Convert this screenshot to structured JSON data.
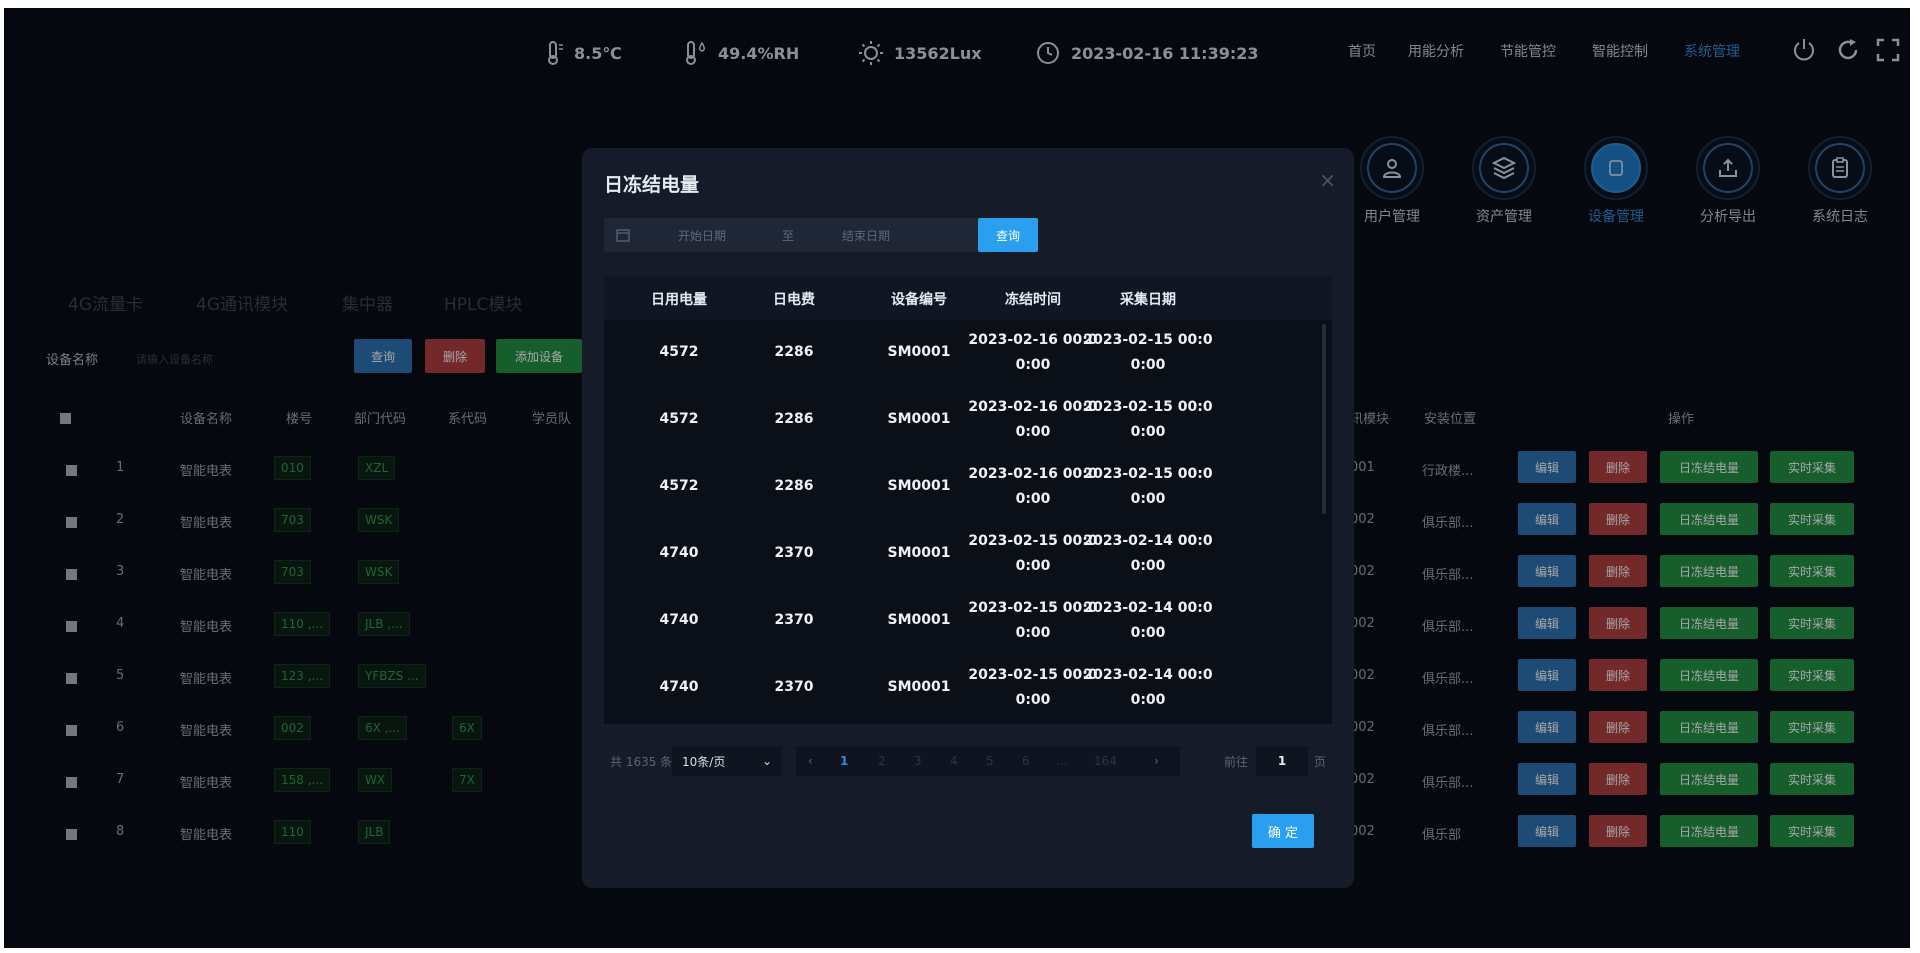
{
  "status": {
    "temperature": "8.5℃",
    "humidity": "49.4%RH",
    "illuminance": "13562Lux",
    "datetime": "2023-02-16 11:39:23"
  },
  "topnav": [
    "首页",
    "用能分析",
    "节能管控",
    "智能控制",
    "系统管理"
  ],
  "system_menu": [
    "用户管理",
    "资产管理",
    "设备管理",
    "分析导出",
    "系统日志"
  ],
  "background": {
    "device_tabs": [
      "4G流量卡",
      "4G通讯模块",
      "集中器",
      "HPLC模块"
    ],
    "filter_label": "设备名称",
    "filter_placeholder": "请输入设备名称",
    "query": "查询",
    "delete": "删除",
    "add_device": "添加设备",
    "columns": [
      "设备名称",
      "楼号",
      "部门代码",
      "系代码",
      "学员队"
    ],
    "right_columns": [
      "讯模块",
      "安装位置",
      "操作"
    ],
    "row_actions": {
      "edit": "编辑",
      "delete": "删除",
      "freeze": "日冻结电量",
      "realtime": "实时采集"
    },
    "rows": [
      {
        "idx": "1",
        "name": "智能电表",
        "building": "010",
        "dept": "XZL",
        "sys": "",
        "module": "001",
        "loc": "行政楼..."
      },
      {
        "idx": "2",
        "name": "智能电表",
        "building": "703",
        "dept": "WSK",
        "sys": "",
        "module": "002",
        "loc": "俱乐部..."
      },
      {
        "idx": "3",
        "name": "智能电表",
        "building": "703",
        "dept": "WSK",
        "sys": "",
        "module": "002",
        "loc": "俱乐部..."
      },
      {
        "idx": "4",
        "name": "智能电表",
        "building": "110 ,...",
        "dept": "JLB ,...",
        "sys": "",
        "module": "002",
        "loc": "俱乐部..."
      },
      {
        "idx": "5",
        "name": "智能电表",
        "building": "123 ,...",
        "dept": "YFBZS ...",
        "sys": "",
        "module": "002",
        "loc": "俱乐部..."
      },
      {
        "idx": "6",
        "name": "智能电表",
        "building": "002",
        "dept": "6X ,...",
        "sys": "6X",
        "module": "002",
        "loc": "俱乐部..."
      },
      {
        "idx": "7",
        "name": "智能电表",
        "building": "158 ,...",
        "dept": "WX",
        "sys": "7X",
        "module": "002",
        "loc": "俱乐部..."
      },
      {
        "idx": "8",
        "name": "智能电表",
        "building": "110",
        "dept": "JLB",
        "sys": "",
        "module": "002",
        "loc": "俱乐部"
      }
    ]
  },
  "dialog": {
    "title": "日冻结电量",
    "close": "×",
    "start_placeholder": "开始日期",
    "to": "至",
    "end_placeholder": "结束日期",
    "query": "查询",
    "columns": [
      "日用电量",
      "日电费",
      "设备编号",
      "冻结时间",
      "采集日期"
    ],
    "rows": [
      {
        "usage": "4572",
        "fee": "2286",
        "device": "SM0001",
        "freeze_time": [
          "2023-02-16 00:0",
          "0:00"
        ],
        "collect_date": [
          "2023-02-15 00:0",
          "0:00"
        ]
      },
      {
        "usage": "4572",
        "fee": "2286",
        "device": "SM0001",
        "freeze_time": [
          "2023-02-16 00:0",
          "0:00"
        ],
        "collect_date": [
          "2023-02-15 00:0",
          "0:00"
        ]
      },
      {
        "usage": "4572",
        "fee": "2286",
        "device": "SM0001",
        "freeze_time": [
          "2023-02-16 00:0",
          "0:00"
        ],
        "collect_date": [
          "2023-02-15 00:0",
          "0:00"
        ]
      },
      {
        "usage": "4740",
        "fee": "2370",
        "device": "SM0001",
        "freeze_time": [
          "2023-02-15 00:0",
          "0:00"
        ],
        "collect_date": [
          "2023-02-14 00:0",
          "0:00"
        ]
      },
      {
        "usage": "4740",
        "fee": "2370",
        "device": "SM0001",
        "freeze_time": [
          "2023-02-15 00:0",
          "0:00"
        ],
        "collect_date": [
          "2023-02-14 00:0",
          "0:00"
        ]
      },
      {
        "usage": "4740",
        "fee": "2370",
        "device": "SM0001",
        "freeze_time": [
          "2023-02-15 00:0",
          "0:00"
        ],
        "collect_date": [
          "2023-02-14 00:0",
          "0:00"
        ]
      }
    ],
    "pagination": {
      "total": "共 1635 条",
      "page_size": "10条/页",
      "pages": [
        "1",
        "2",
        "3",
        "4",
        "5",
        "6",
        "...",
        "164"
      ],
      "current": "1",
      "goto_label": "前往",
      "goto_value": "1",
      "page_suffix": "页"
    },
    "confirm": "确 定"
  }
}
